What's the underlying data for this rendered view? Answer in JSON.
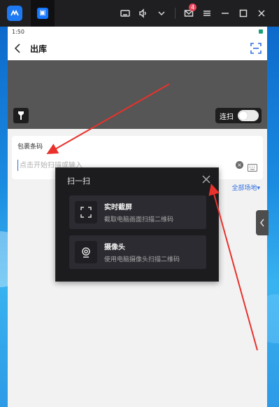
{
  "emulator": {
    "mail_badge": "4"
  },
  "phone": {
    "status_time": "1:50",
    "nav_title": "出库",
    "continuous_label": "连扫",
    "form": {
      "label": "包裹条码",
      "placeholder": "点击开始扫描或输入"
    },
    "all_sites": "全部场地▾"
  },
  "popup": {
    "title": "扫一扫",
    "options": [
      {
        "title": "实时截屏",
        "desc": "截取电脑画面扫描二维码"
      },
      {
        "title": "摄像头",
        "desc": "使用电脑摄像头扫描二维码"
      }
    ]
  },
  "colors": {
    "accent": "#2f6fe0",
    "annotation": "#e8322b"
  }
}
